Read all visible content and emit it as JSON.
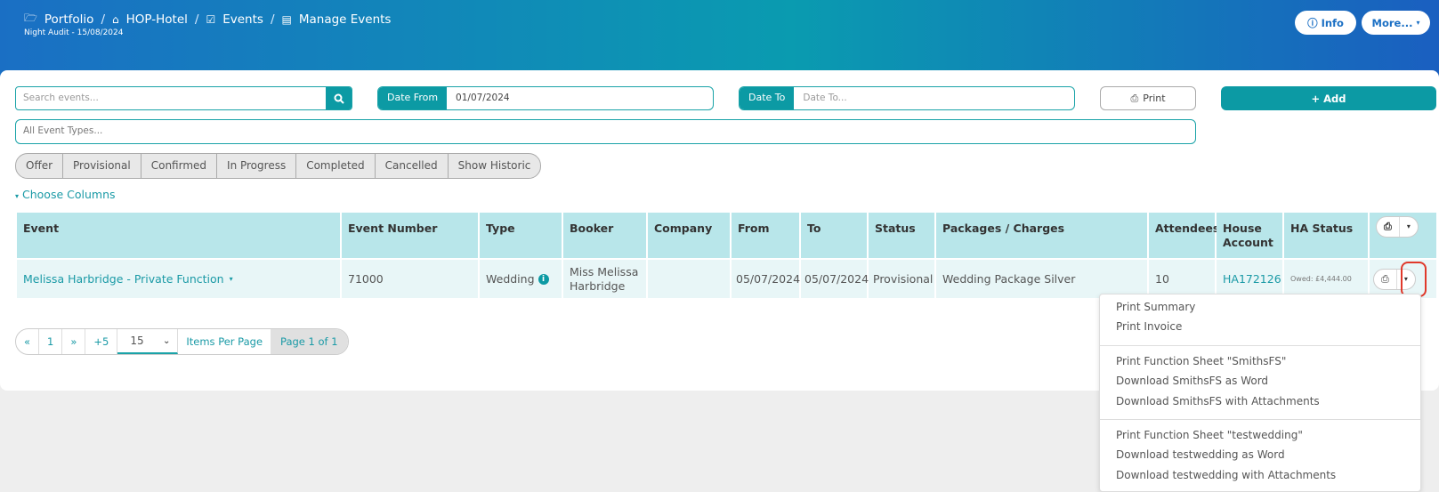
{
  "breadcrumb": [
    {
      "icon": "folder-open-icon",
      "glyph": "🗁",
      "label": "Portfolio"
    },
    {
      "icon": "home-icon",
      "glyph": "⌂",
      "label": "HOP-Hotel"
    },
    {
      "icon": "calendar-check-icon",
      "glyph": "☑",
      "label": "Events"
    },
    {
      "icon": "list-icon",
      "glyph": "▤",
      "label": "Manage Events"
    }
  ],
  "night_audit": "Night Audit - 15/08/2024",
  "header_buttons": {
    "info": "Info",
    "more": "More..."
  },
  "search": {
    "placeholder": "Search events..."
  },
  "date_from": {
    "label": "Date From",
    "value": "01/07/2024"
  },
  "date_to": {
    "label": "Date To",
    "placeholder": "Date To..."
  },
  "print_label": "Print",
  "add_label": "Add",
  "event_types_placeholder": "All Event Types...",
  "status_filters": [
    "Offer",
    "Provisional",
    "Confirmed",
    "In Progress",
    "Completed",
    "Cancelled",
    "Show Historic"
  ],
  "choose_columns": "Choose Columns",
  "columns": [
    "Event",
    "Event Number",
    "Type",
    "Booker",
    "Company",
    "From",
    "To",
    "Status",
    "Packages / Charges",
    "Attendees",
    "House Account",
    "HA Status"
  ],
  "rows": [
    {
      "event": "Melissa Harbridge - Private Function",
      "event_number": "71000",
      "type": "Wedding",
      "booker": "Miss Melissa Harbridge",
      "company": "",
      "from": "05/07/2024",
      "to": "05/07/2024",
      "status": "Provisional",
      "packages": "Wedding Package Silver",
      "attendees": "10",
      "house_account": "HA172126",
      "ha_status": "Owed: £4,444.00"
    }
  ],
  "pagination": {
    "first": "«",
    "page": "1",
    "last": "»",
    "jump": "+5",
    "per_page": "15",
    "per_page_label": "Items Per Page",
    "page_info": "Page 1 of 1"
  },
  "dropdown_menu": [
    [
      "Print Summary",
      "Print Invoice"
    ],
    [
      "Print Function Sheet \"SmithsFS\"",
      "Download SmithsFS as Word",
      "Download SmithsFS with Attachments"
    ],
    [
      "Print Function Sheet \"testwedding\"",
      "Download testwedding as Word",
      "Download testwedding with Attachments"
    ]
  ],
  "colors": {
    "accent": "#0c9aa4",
    "header_start": "#1a6fc4",
    "header_mid": "#0a9bb0",
    "table_header": "#b8e6ea",
    "row_bg": "#e8f6f7",
    "highlight": "#e0392b"
  }
}
